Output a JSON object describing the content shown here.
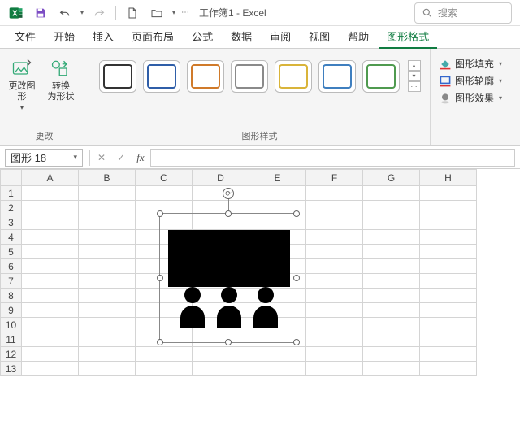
{
  "titlebar": {
    "doc_title": "工作簿1 - Excel",
    "search_placeholder": "搜索"
  },
  "tabs": [
    "文件",
    "开始",
    "插入",
    "页面布局",
    "公式",
    "数据",
    "审阅",
    "视图",
    "帮助",
    "图形格式"
  ],
  "active_tab_index": 9,
  "ribbon": {
    "group_change": {
      "label": "更改",
      "change_graphic": "更改图\n形",
      "convert": "转换\n为形状"
    },
    "group_styles": {
      "label": "图形样式",
      "swatch_colors": [
        "#333333",
        "#2f5ea8",
        "#d07a2a",
        "#8a8a8a",
        "#d9b43a",
        "#3f7fbf",
        "#4f9a4f"
      ]
    },
    "group_options": {
      "fill": "图形填充",
      "outline": "图形轮廓",
      "effects": "图形效果"
    }
  },
  "namebox": "图形 18",
  "columns": [
    "A",
    "B",
    "C",
    "D",
    "E",
    "F",
    "G",
    "H"
  ],
  "rows": [
    "1",
    "2",
    "3",
    "4",
    "5",
    "6",
    "7",
    "8",
    "9",
    "10",
    "11",
    "12",
    "13"
  ]
}
